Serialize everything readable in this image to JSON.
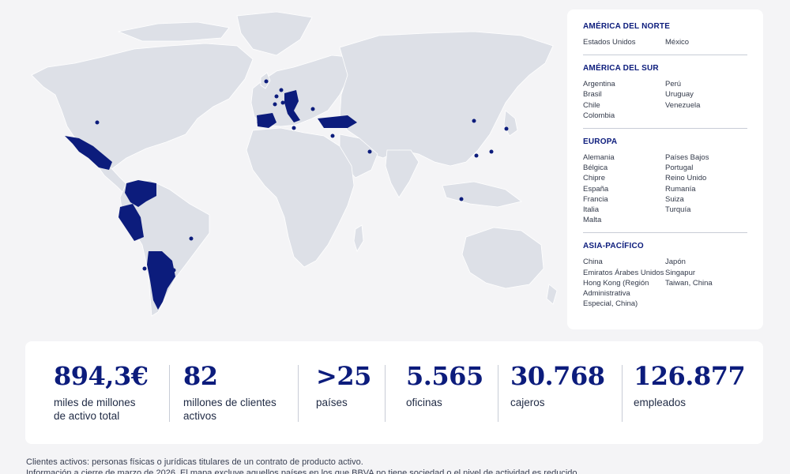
{
  "regions": [
    {
      "title": "AMÉRICA DEL NORTE",
      "col1": [
        "Estados Unidos"
      ],
      "col2": [
        "México"
      ]
    },
    {
      "title": "AMÉRICA DEL SUR",
      "col1": [
        "Argentina",
        "Brasil",
        "Chile",
        "Colombia"
      ],
      "col2": [
        "Perú",
        "Uruguay",
        "Venezuela"
      ]
    },
    {
      "title": "EUROPA",
      "col1": [
        "Alemania",
        "Bélgica",
        "Chipre",
        "España",
        "Francia",
        "Italia",
        "Malta"
      ],
      "col2": [
        "Países Bajos",
        "Portugal",
        "Reino Unido",
        "Rumanía",
        "Suiza",
        "Turquía"
      ]
    },
    {
      "title": "ASIA-PACÍFICO",
      "col1": [
        "China",
        "Emiratos Árabes Unidos",
        "Hong Kong (Región",
        "Administrativa",
        "Especial, China)"
      ],
      "col2": [
        "Japón",
        "Singapur",
        "Taiwan, China"
      ]
    }
  ],
  "stats": [
    {
      "value": "894,3€",
      "label_lines": [
        "miles de millones",
        "de activo total"
      ]
    },
    {
      "value": "82",
      "label_lines": [
        "millones de clientes",
        "activos"
      ]
    },
    {
      "value": ">25",
      "label_lines": [
        "países"
      ]
    },
    {
      "value": "5.565",
      "label_lines": [
        "oficinas"
      ]
    },
    {
      "value": "30.768",
      "label_lines": [
        "cajeros"
      ]
    },
    {
      "value": "126.877",
      "label_lines": [
        "empleados"
      ]
    }
  ],
  "footnote": {
    "line1": "Clientes activos: personas físicas o jurídicas titulares de un contrato de producto activo.",
    "line2": "Información a cierre de marzo de 2026. El mapa excluye aquellos países en los que BBVA no tiene sociedad o el nivel de actividad es reducido."
  },
  "colors": {
    "land": "#dde0e7",
    "highlight": "#0c1c7c",
    "background": "#f4f4f6"
  }
}
